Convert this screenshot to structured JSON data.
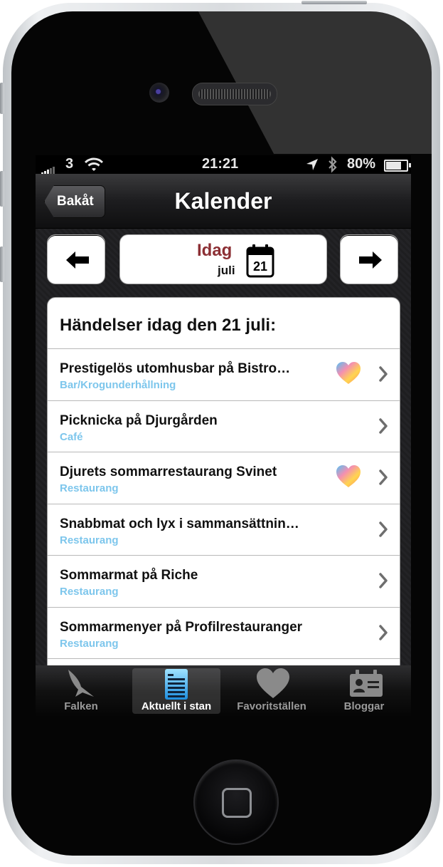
{
  "statusbar": {
    "carrier": "3",
    "time": "21:21",
    "battery": "80%",
    "battery_level": 0.8
  },
  "navbar": {
    "back_label": "Bakåt",
    "title": "Kalender"
  },
  "date_selector": {
    "today_label": "Idag",
    "month_label": "juli",
    "calendar_day": "21"
  },
  "list": {
    "header": "Händelser idag den 21 juli:",
    "items": [
      {
        "title": "Prestigelös utomhusbar på Bistro…",
        "category": "Bar/Krogunderhållning",
        "favorite": true
      },
      {
        "title": "Picknicka på Djurgården",
        "category": "Café",
        "favorite": false
      },
      {
        "title": "Djurets sommarrestaurang Svinet",
        "category": "Restaurang",
        "favorite": true
      },
      {
        "title": "Snabbmat och lyx i sammansättnin…",
        "category": "Restaurang",
        "favorite": false
      },
      {
        "title": "Sommarmat på Riche",
        "category": "Restaurang",
        "favorite": false
      },
      {
        "title": "Sommarmenyer på Profilrestauranger",
        "category": "Restaurang",
        "favorite": false
      }
    ]
  },
  "tabbar": {
    "tabs": [
      {
        "label": "Falken",
        "icon": "falcon-icon",
        "active": false
      },
      {
        "label": "Aktuellt i stan",
        "icon": "document-icon",
        "active": true
      },
      {
        "label": "Favoritställen",
        "icon": "heart-icon",
        "active": false
      },
      {
        "label": "Bloggar",
        "icon": "id-card-icon",
        "active": false
      }
    ]
  },
  "colors": {
    "today_text": "#8c2f34",
    "category_text": "#7dc6ec",
    "active_tab_text": "#ffffff",
    "inactive_tab_text": "#9a9a9a"
  }
}
